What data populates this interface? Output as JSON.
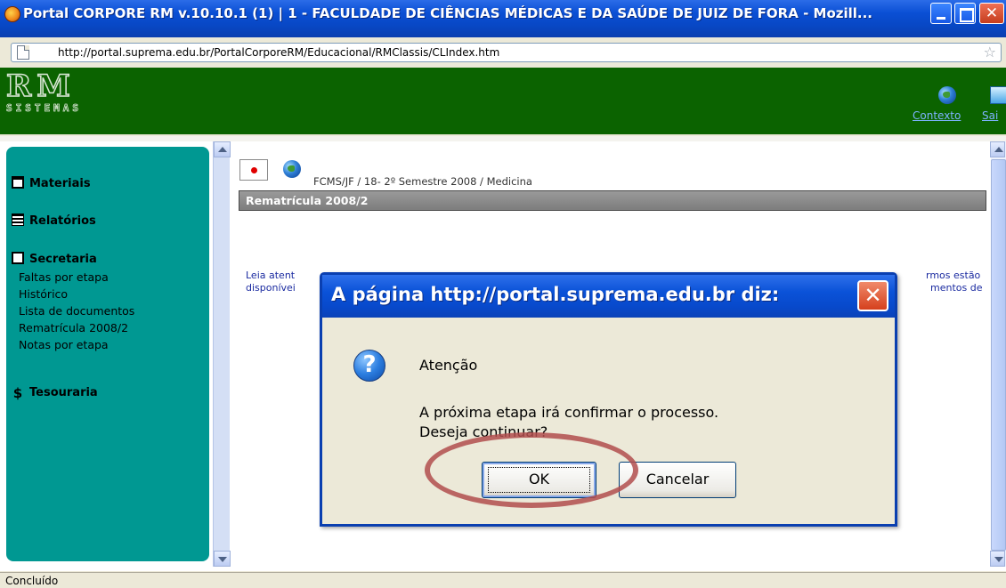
{
  "window": {
    "title": "Portal CORPORE RM v.10.10.1 (1) | 1 - FACULDADE DE CIÊNCIAS MÉDICAS E DA SAÚDE DE JUIZ DE FORA - Mozill...",
    "url": "http://portal.suprema.edu.br/PortalCorporeRM/Educacional/RMClassis/CLIndex.htm",
    "status": "Concluído"
  },
  "banner": {
    "logo_main": "RM",
    "logo_sub": "SISTEMAS",
    "contexto_label": "Contexto",
    "sair_label": "Sai"
  },
  "sidebar": {
    "materiais": "Materiais",
    "relatorios": "Relatórios",
    "secretaria": "Secretaria",
    "secretaria_items": [
      "Faltas por etapa",
      "Histórico",
      "Lista de documentos",
      "Rematrícula 2008/2",
      "Notas por etapa"
    ],
    "tesouraria": "Tesouraria"
  },
  "content": {
    "breadcrumb": "FCMS/JF / 18- 2º Semestre 2008  / Medicina",
    "section_title": "Rematrícula 2008/2",
    "text_left_1": "Leia atent",
    "text_left_2": "disponívei",
    "text_right_1": "rmos estão",
    "text_right_2": "mentos de"
  },
  "dialog": {
    "title": "A página http://portal.suprema.edu.br diz:",
    "heading": "Atenção",
    "message_1": "A próxima etapa irá confirmar o processo.",
    "message_2": "Deseja continuar?",
    "ok_label": "OK",
    "cancel_label": "Cancelar"
  },
  "colors": {
    "banner_green": "#0b6300",
    "sidebar_teal": "#009892",
    "highlight_ring": "#b24d4d"
  },
  "icons": [
    "firefox-icon",
    "page-icon",
    "star-icon",
    "globe-icon",
    "exit-icon",
    "record-icon",
    "question-icon",
    "close-icon"
  ]
}
